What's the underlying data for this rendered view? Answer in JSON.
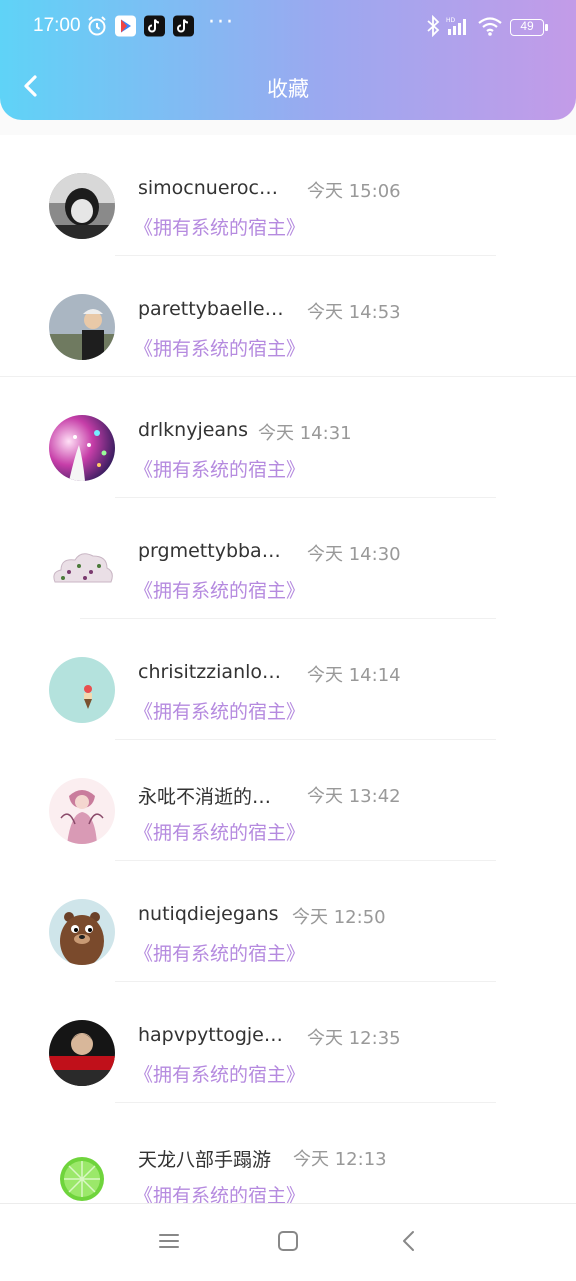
{
  "status_bar": {
    "time": "17:00",
    "dots": "···",
    "battery": "49"
  },
  "header": {
    "title": "收藏"
  },
  "items": [
    {
      "name": "simocnueroc…",
      "time": "今天 15:06",
      "book": "《拥有系统的宿主》",
      "avatar": "avatar-bw-child"
    },
    {
      "name": "parettybaelle…",
      "time": "今天 14:53",
      "book": "《拥有系统的宿主》",
      "avatar": "avatar-man-cap"
    },
    {
      "name": "drlknyjeans",
      "time": "今天 14:31",
      "book": "《拥有系统的宿主》",
      "avatar": "avatar-sparkles"
    },
    {
      "name": "prgmettybba…",
      "time": "今天 14:30",
      "book": "《拥有系统的宿主》",
      "avatar": "avatar-cloud"
    },
    {
      "name": "chrisitzzianlo…",
      "time": "今天 14:14",
      "book": "《拥有系统的宿主》",
      "avatar": "avatar-teal-icecream"
    },
    {
      "name": "永吡不消逝的…",
      "time": "今天 13:42",
      "book": "《拥有系统的宿主》",
      "avatar": "avatar-illustration"
    },
    {
      "name": "nutiqdiejegans",
      "time": "今天 12:50",
      "book": "《拥有系统的宿主》",
      "avatar": "avatar-bear"
    },
    {
      "name": "hapvpyttogje…",
      "time": "今天 12:35",
      "book": "《拥有系统的宿主》",
      "avatar": "avatar-dark-red"
    },
    {
      "name": "天龙八部手蹋游",
      "time": "今天 12:13",
      "book": "《拥有系统的宿主》",
      "avatar": "avatar-lime"
    }
  ],
  "colors": {
    "accent": "#b58adf",
    "header_start": "#5fd3f7",
    "header_end": "#c39be8"
  }
}
